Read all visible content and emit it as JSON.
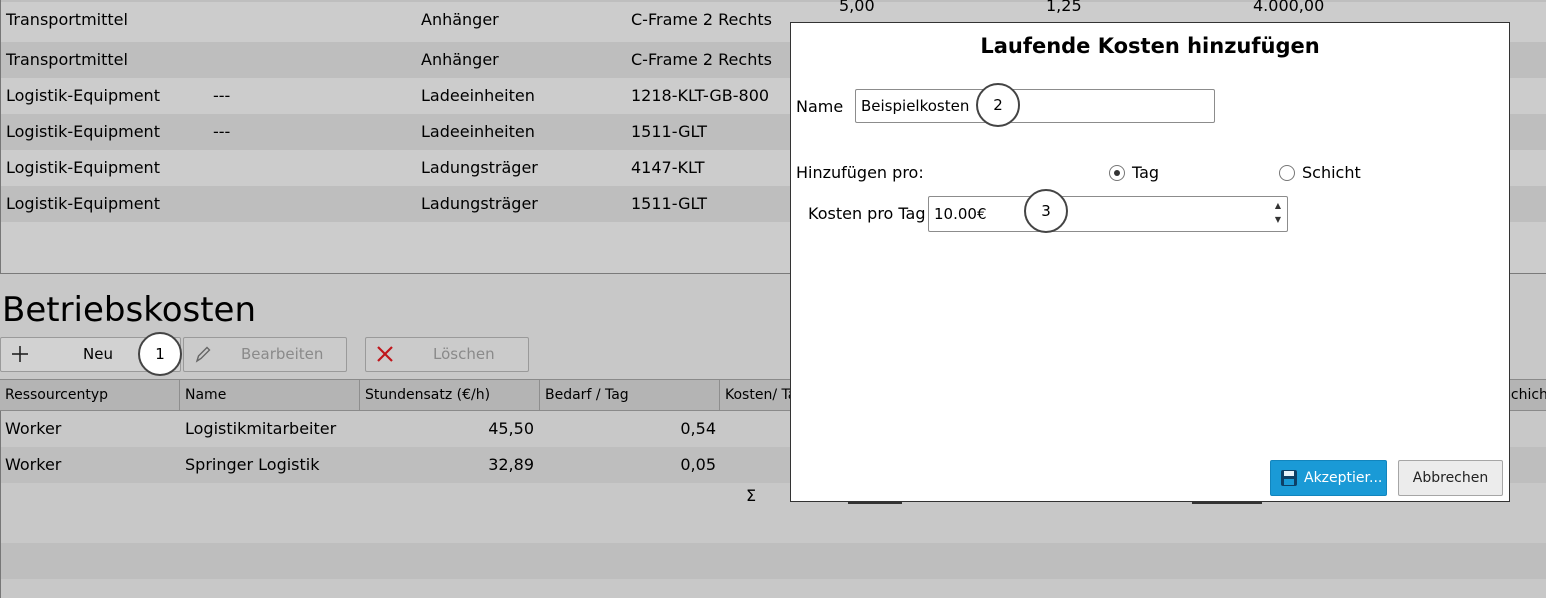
{
  "resource_table": {
    "rows": [
      {
        "category": "Transportmittel",
        "sub": "",
        "type": "Anhänger",
        "item": "C-Frame 2 Rechts",
        "v1": "5,00",
        "v2": "1,25",
        "v3": "4.000,00"
      },
      {
        "category": "Transportmittel",
        "sub": "",
        "type": "Anhänger",
        "item": "C-Frame 2 Rechts",
        "v1": "",
        "v2": "",
        "v3": ""
      },
      {
        "category": "Logistik-Equipment",
        "sub": "---",
        "type": "Ladeeinheiten",
        "item": "1218-KLT-GB-800",
        "v1": "",
        "v2": "",
        "v3": ""
      },
      {
        "category": "Logistik-Equipment",
        "sub": "---",
        "type": "Ladeeinheiten",
        "item": "1511-GLT",
        "v1": "",
        "v2": "",
        "v3": ""
      },
      {
        "category": "Logistik-Equipment",
        "sub": "",
        "type": "Ladungsträger",
        "item": "4147-KLT",
        "v1": "",
        "v2": "",
        "v3": ""
      },
      {
        "category": "Logistik-Equipment",
        "sub": "",
        "type": "Ladungsträger",
        "item": "1511-GLT",
        "v1": "",
        "v2": "",
        "v3": ""
      }
    ]
  },
  "section": {
    "title": "Betriebskosten"
  },
  "toolbar": {
    "new_label": "Neu",
    "edit_label": "Bearbeiten",
    "delete_label": "Löschen"
  },
  "cost_table": {
    "headers": {
      "resource_type": "Ressourcentyp",
      "name": "Name",
      "hourly_rate": "Stundensatz (€/h)",
      "demand_day": "Bedarf / Tag",
      "cost_day": "Kosten/ Tag",
      "cost_shift": "Schicht"
    },
    "rows": [
      {
        "type": "Worker",
        "name": "Logistikmitarbeiter",
        "rate": "45,50",
        "demand": "0,54"
      },
      {
        "type": "Worker",
        "name": "Springer Logistik",
        "rate": "32,89",
        "demand": "0,05"
      }
    ],
    "sum_symbol": "Σ"
  },
  "callouts": {
    "c1": "1",
    "c2": "2",
    "c3": "3"
  },
  "dialog": {
    "title": "Laufende Kosten hinzufügen",
    "name_label": "Name",
    "name_value": "Beispielkosten",
    "add_per_label": "Hinzufügen pro:",
    "option_day": "Tag",
    "option_shift": "Schicht",
    "selected_option": "Tag",
    "cost_per_day_label": "Kosten pro Tag",
    "cost_value": "10.00€",
    "accept_label": "Akzeptier...",
    "cancel_label": "Abbrechen"
  },
  "colors": {
    "accent": "#1a9ad6",
    "delete_icon": "#c0161b"
  }
}
